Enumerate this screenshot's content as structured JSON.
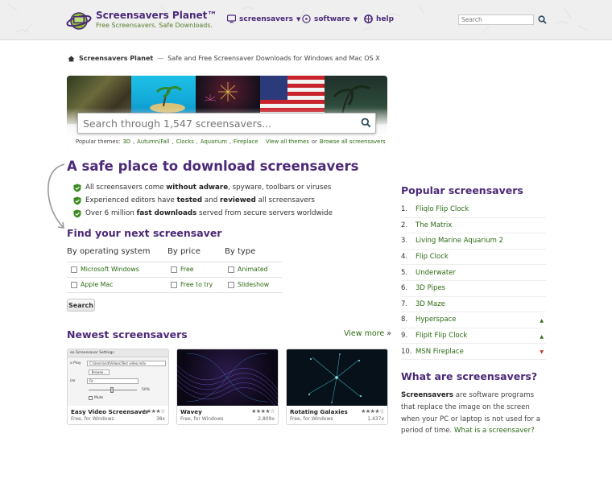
{
  "header": {
    "brand": "Screensavers Planet™",
    "tagline": "Free Screensavers. Safe Downloads.",
    "nav": [
      {
        "label": "screensavers",
        "icon": "monitor-icon",
        "dropdown": true
      },
      {
        "label": "software",
        "icon": "cd-icon",
        "dropdown": true
      },
      {
        "label": "help",
        "icon": "lifebuoy-icon",
        "dropdown": false
      }
    ],
    "search_placeholder": "Search"
  },
  "breadcrumb": {
    "home": "Screensavers Planet",
    "separator": "—",
    "description": "Safe and Free Screensaver Downloads for Windows and Mac OS X"
  },
  "hero": {
    "search_placeholder": "Search through 1,547 screensavers...",
    "themes_label": "Popular themes:",
    "themes": [
      "3D",
      "Autumn/Fall",
      "Clocks",
      "Aquarium",
      "Fireplace"
    ],
    "view_all_themes": "View all themes",
    "or_text": "or",
    "browse_all": "Browse all screensavers"
  },
  "intro": {
    "headline": "A safe place to download screensavers",
    "bullets": [
      {
        "pre": "All screensavers come ",
        "bold": "without adware",
        "post": ", spyware, toolbars or viruses"
      },
      {
        "pre": "Experienced editors have ",
        "bold": "tested",
        "mid": " and ",
        "bold2": "reviewed",
        "post": " all screensavers"
      },
      {
        "pre": "Over 6 million ",
        "bold": "fast downloads",
        "post": " served from secure servers worldwide"
      }
    ]
  },
  "finder": {
    "title": "Find your next screensaver",
    "columns": [
      {
        "heading": "By operating system",
        "options": [
          "Microsoft Windows",
          "Apple Mac"
        ]
      },
      {
        "heading": "By price",
        "options": [
          "Free",
          "Free to try"
        ]
      },
      {
        "heading": "By type",
        "options": [
          "Animated",
          "Slideshow"
        ]
      }
    ],
    "button": "Search"
  },
  "newest": {
    "title": "Newest screensavers",
    "view_more": "View more",
    "view_more_arrow": "»",
    "cards": [
      {
        "title": "Easy Video Screensaver",
        "sub": "Free, for Windows",
        "stars": "★★★★☆",
        "count": "38x",
        "dialog": {
          "bar": "eo Screensaver Settings",
          "play": "o Play",
          "path": "C:\\Users\\vid\\Videos\\Test video.m4v",
          "browse": "Browse...",
          "fit": "Fit",
          "ize": "ize",
          "pct": "50%",
          "mute": "Mute"
        }
      },
      {
        "title": "Wavey",
        "sub": "Free, for Windows",
        "stars": "★★★★☆",
        "count": "2,809x"
      },
      {
        "title": "Rotating Galaxies",
        "sub": "Free, for Windows",
        "stars": "★★★★☆",
        "count": "1,437x"
      }
    ]
  },
  "popular": {
    "title": "Popular screensavers",
    "items": [
      {
        "num": "1.",
        "name": "Fliqlo Flip Clock",
        "trend": ""
      },
      {
        "num": "2.",
        "name": "The Matrix",
        "trend": ""
      },
      {
        "num": "3.",
        "name": "Living Marine Aquarium 2",
        "trend": ""
      },
      {
        "num": "4.",
        "name": "Flip Clock",
        "trend": ""
      },
      {
        "num": "5.",
        "name": "Underwater",
        "trend": ""
      },
      {
        "num": "6.",
        "name": "3D Pipes",
        "trend": ""
      },
      {
        "num": "7.",
        "name": "3D Maze",
        "trend": ""
      },
      {
        "num": "8.",
        "name": "Hyperspace",
        "trend": "▲"
      },
      {
        "num": "9.",
        "name": "FlipIt Flip Clock",
        "trend": "▲"
      },
      {
        "num": "10.",
        "name": "MSN Fireplace",
        "trend": "▼"
      }
    ],
    "colors": {
      "up": "#2d6a13",
      "down": "#c0392b"
    }
  },
  "what": {
    "title": "What are screensavers?",
    "bold": "Screensavers",
    "text": " are software programs that replace the image on the screen when your PC or laptop is not used for a period of time. ",
    "link": "What is a screensaver?"
  },
  "colors": {
    "purple": "#4b2a78",
    "green": "#2d6a13"
  }
}
